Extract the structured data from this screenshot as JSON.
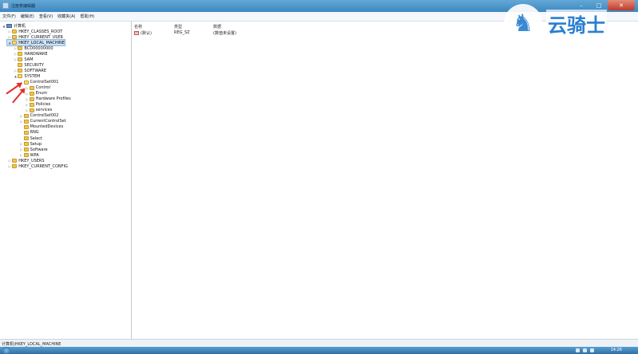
{
  "window": {
    "title": "注册表编辑器"
  },
  "menu": [
    "文件(F)",
    "编辑(E)",
    "查看(V)",
    "收藏夹(A)",
    "帮助(H)"
  ],
  "tree": [
    {
      "label": "计算机",
      "indent": 0,
      "twisty": "▲",
      "icon": "pc"
    },
    {
      "label": "HKEY_CLASSES_ROOT",
      "indent": 1,
      "twisty": "▷",
      "icon": "folder"
    },
    {
      "label": "HKEY_CURRENT_USER",
      "indent": 1,
      "twisty": "▷",
      "icon": "folder"
    },
    {
      "label": "HKEY_LOCAL_MACHINE",
      "indent": 1,
      "twisty": "▲",
      "icon": "folder-open",
      "selected": true
    },
    {
      "label": "BCD00000000",
      "indent": 2,
      "twisty": "▷",
      "icon": "folder"
    },
    {
      "label": "HARDWARE",
      "indent": 2,
      "twisty": "▷",
      "icon": "folder"
    },
    {
      "label": "SAM",
      "indent": 2,
      "twisty": "▷",
      "icon": "folder"
    },
    {
      "label": "SECURITY",
      "indent": 2,
      "twisty": "",
      "icon": "folder"
    },
    {
      "label": "SOFTWARE",
      "indent": 2,
      "twisty": "▷",
      "icon": "folder"
    },
    {
      "label": "SYSTEM",
      "indent": 2,
      "twisty": "▲",
      "icon": "folder-open"
    },
    {
      "label": "ControlSet001",
      "indent": 3,
      "twisty": "▲",
      "icon": "folder-open"
    },
    {
      "label": "Control",
      "indent": 4,
      "twisty": "▷",
      "icon": "folder"
    },
    {
      "label": "Enum",
      "indent": 4,
      "twisty": "▷",
      "icon": "folder"
    },
    {
      "label": "Hardware Profiles",
      "indent": 4,
      "twisty": "▷",
      "icon": "folder"
    },
    {
      "label": "Policies",
      "indent": 4,
      "twisty": "▷",
      "icon": "folder"
    },
    {
      "label": "services",
      "indent": 4,
      "twisty": "▷",
      "icon": "folder"
    },
    {
      "label": "ControlSet002",
      "indent": 3,
      "twisty": "▷",
      "icon": "folder"
    },
    {
      "label": "CurrentControlSet",
      "indent": 3,
      "twisty": "▷",
      "icon": "folder"
    },
    {
      "label": "MountedDevices",
      "indent": 3,
      "twisty": "",
      "icon": "folder"
    },
    {
      "label": "RNG",
      "indent": 3,
      "twisty": "",
      "icon": "folder"
    },
    {
      "label": "Select",
      "indent": 3,
      "twisty": "",
      "icon": "folder"
    },
    {
      "label": "Setup",
      "indent": 3,
      "twisty": "▷",
      "icon": "folder"
    },
    {
      "label": "Software",
      "indent": 3,
      "twisty": "▷",
      "icon": "folder"
    },
    {
      "label": "WPA",
      "indent": 3,
      "twisty": "▷",
      "icon": "folder"
    },
    {
      "label": "HKEY_USERS",
      "indent": 1,
      "twisty": "▷",
      "icon": "folder"
    },
    {
      "label": "HKEY_CURRENT_CONFIG",
      "indent": 1,
      "twisty": "▷",
      "icon": "folder"
    }
  ],
  "list": {
    "headers": {
      "name": "名称",
      "type": "类型",
      "data": "数据"
    },
    "rows": [
      {
        "name": "(默认)",
        "type": "REG_SZ",
        "data": "(数值未设置)",
        "icon": "string-value-icon"
      }
    ]
  },
  "status": {
    "path": "计算机\\HKEY_LOCAL_MACHINE"
  },
  "taskbar": {
    "clock": "14:26"
  },
  "watermark": {
    "text": "云骑士"
  },
  "colors": {
    "selection": "#cde3f7",
    "titlebar": "#3d88c2",
    "close": "#c0392b",
    "annotation_arrow": "#e0302a",
    "watermark": "#2a7fd0"
  }
}
